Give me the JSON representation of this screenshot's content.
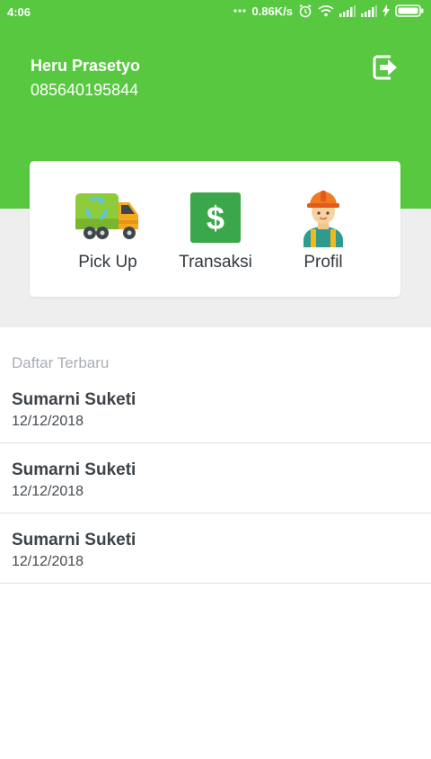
{
  "status_bar": {
    "time": "4:06",
    "network_speed": "0.86K/s",
    "icons": [
      "dots-icon",
      "alarm-icon",
      "wifi-icon",
      "signal-icon",
      "signal-icon",
      "charging-icon",
      "battery-icon"
    ]
  },
  "header": {
    "user_name": "Heru Prasetyo",
    "phone": "085640195844",
    "logout_icon": "logout-icon",
    "background_color": "#57c840"
  },
  "menu": {
    "items": [
      {
        "label": "Pick Up",
        "icon": "garbage-truck-icon"
      },
      {
        "label": "Transaksi",
        "icon": "dollar-icon"
      },
      {
        "label": "Profil",
        "icon": "worker-icon"
      }
    ]
  },
  "recent": {
    "title": "Daftar Terbaru",
    "items": [
      {
        "name": "Sumarni Suketi",
        "date": "12/12/2018"
      },
      {
        "name": "Sumarni Suketi",
        "date": "12/12/2018"
      },
      {
        "name": "Sumarni Suketi",
        "date": "12/12/2018"
      }
    ]
  }
}
